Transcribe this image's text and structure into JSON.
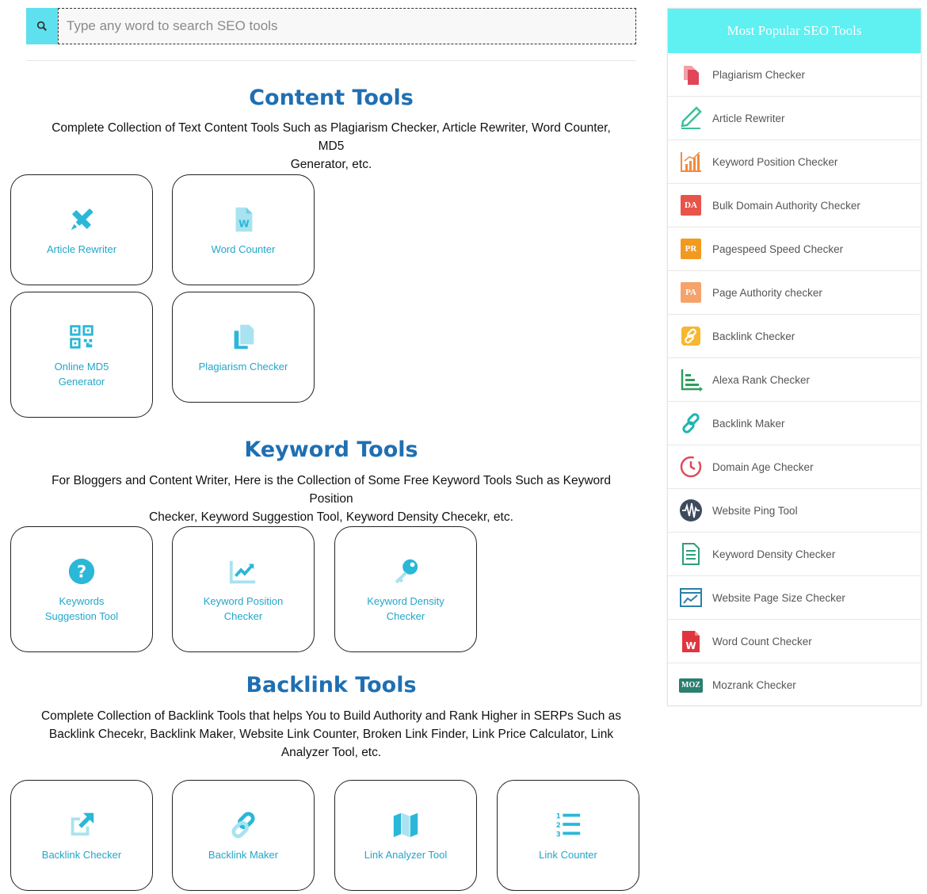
{
  "search": {
    "placeholder": "Type any word to search SEO tools"
  },
  "sections": {
    "content": {
      "title": "Content Tools",
      "desc_line1": "Complete Collection of Text Content Tools Such as Plagiarism Checker, Article Rewriter, Word Counter, MD5",
      "desc_line2": "Generator, etc.",
      "cards": [
        "Article Rewriter",
        "Word Counter",
        "Online MD5 Generator",
        "Plagiarism Checker"
      ]
    },
    "keyword": {
      "title": "Keyword Tools",
      "desc_line1": "For Bloggers and Content Writer, Here is the Collection of Some Free Keyword Tools Such as Keyword Position",
      "desc_line2": "Checker, Keyword Suggestion Tool, Keyword Density Checekr, etc.",
      "cards": [
        "Keywords Suggestion Tool",
        "Keyword Position Checker",
        "Keyword Density Checker"
      ]
    },
    "backlink": {
      "title": "Backlink Tools",
      "desc_line1": "Complete Collection of Backlink Tools that helps You to Build Authority and Rank Higher in SERPs Such as",
      "desc_line2": "Backlink Checekr, Backlink Maker, Website Link Counter, Broken Link Finder, Link Price Calculator, Link",
      "desc_line3": "Analyzer Tool, etc.",
      "cards": [
        "Backlink Checker",
        "Backlink Maker",
        "Link Analyzer Tool",
        "Link Counter"
      ]
    }
  },
  "sidebar": {
    "title": "Most Popular SEO Tools",
    "items": [
      {
        "label": "Plagiarism Checker",
        "icon": "plagiarism-icon"
      },
      {
        "label": "Article Rewriter",
        "icon": "pencil-icon"
      },
      {
        "label": "Keyword Position Checker",
        "icon": "bar-chart-icon"
      },
      {
        "label": "Bulk Domain Authority Checker",
        "icon": "da-badge-icon",
        "badge": "DA"
      },
      {
        "label": "Pagespeed Speed Checker",
        "icon": "pr-badge-icon",
        "badge": "PR"
      },
      {
        "label": "Page Authority checker",
        "icon": "pa-badge-icon",
        "badge": "PA"
      },
      {
        "label": "Backlink Checker",
        "icon": "link-icon"
      },
      {
        "label": "Alexa Rank Checker",
        "icon": "rank-chart-icon"
      },
      {
        "label": "Backlink Maker",
        "icon": "chain-icon"
      },
      {
        "label": "Domain Age Checker",
        "icon": "clock-icon"
      },
      {
        "label": "Website Ping Tool",
        "icon": "ping-wave-icon"
      },
      {
        "label": "Keyword Density Checker",
        "icon": "document-lines-icon"
      },
      {
        "label": "Website Page Size Checker",
        "icon": "browser-chart-icon"
      },
      {
        "label": "Word Count Checker",
        "icon": "word-doc-icon"
      },
      {
        "label": "Mozrank Checker",
        "icon": "moz-badge-icon",
        "badge": "MOZ"
      }
    ]
  },
  "colors": {
    "accent": "#5fe0ee",
    "heading": "#1f6fb2",
    "card_text": "#22a6c9"
  }
}
